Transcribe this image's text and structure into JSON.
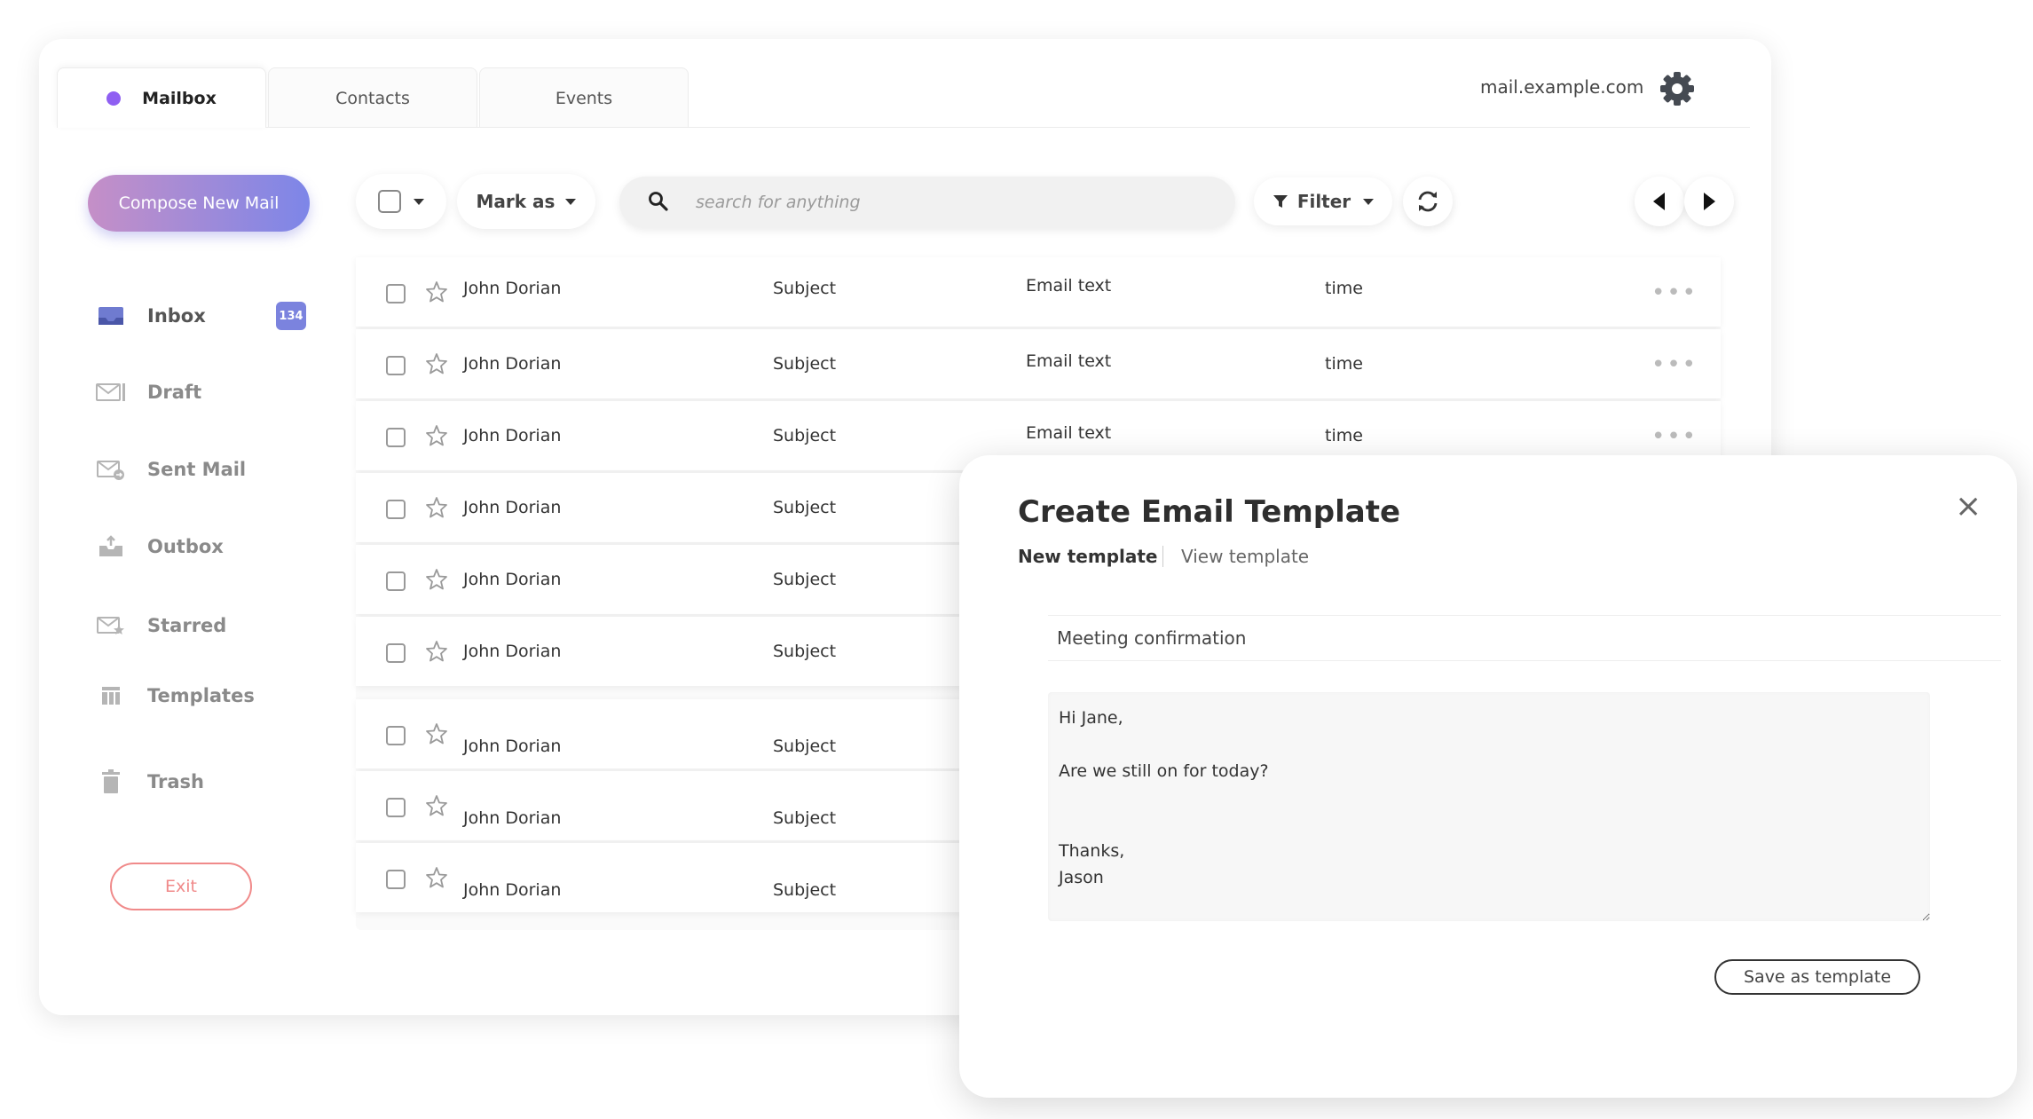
{
  "tabs": [
    {
      "label": "Mailbox",
      "active": true
    },
    {
      "label": "Contacts",
      "active": false
    },
    {
      "label": "Events",
      "active": false
    }
  ],
  "header": {
    "domain": "mail.example.com",
    "settings_icon": "gear-icon"
  },
  "sidebar": {
    "compose_label": "Compose New Mail",
    "items": [
      {
        "label": "Inbox",
        "icon": "inbox-icon",
        "badge": "134"
      },
      {
        "label": "Draft",
        "icon": "draft-icon"
      },
      {
        "label": "Sent Mail",
        "icon": "sent-mail-icon"
      },
      {
        "label": "Outbox",
        "icon": "outbox-icon"
      },
      {
        "label": "Starred",
        "icon": "starred-mail-icon"
      },
      {
        "label": "Templates",
        "icon": "templates-icon"
      },
      {
        "label": "Trash",
        "icon": "trash-icon"
      }
    ],
    "exit_label": "Exit"
  },
  "toolbar": {
    "mark_as_label": "Mark as",
    "search_placeholder": "search for anything",
    "filter_label": "Filter"
  },
  "emails": [
    {
      "sender": "John Dorian",
      "subject": "Subject",
      "text": "Email text",
      "time": "time"
    },
    {
      "sender": "John Dorian",
      "subject": "Subject",
      "text": "Email text",
      "time": "time"
    },
    {
      "sender": "John Dorian",
      "subject": "Subject",
      "text": "Email text",
      "time": "time"
    },
    {
      "sender": "John Dorian",
      "subject": "Subject"
    },
    {
      "sender": "John Dorian",
      "subject": "Subject"
    },
    {
      "sender": "John Dorian",
      "subject": "Subject"
    },
    {
      "sender": "John Dorian",
      "subject": "Subject"
    },
    {
      "sender": "John Dorian",
      "subject": "Subject"
    },
    {
      "sender": "John Dorian",
      "subject": "Subject"
    }
  ],
  "modal": {
    "title": "Create Email Template",
    "tab_new": "New template",
    "tab_view": "View template",
    "template_name": "Meeting confirmation",
    "template_body": "Hi Jane,\n\nAre we still on for today?\n\n\nThanks,\nJason",
    "save_label": "Save as template",
    "close_symbol": "×"
  },
  "colors": {
    "accent_purple": "#8f5ff2",
    "compose_gradient_start": "#c58fc7",
    "compose_gradient_end": "#7d86e8",
    "badge": "#7b83de",
    "exit": "#f08a8a"
  }
}
